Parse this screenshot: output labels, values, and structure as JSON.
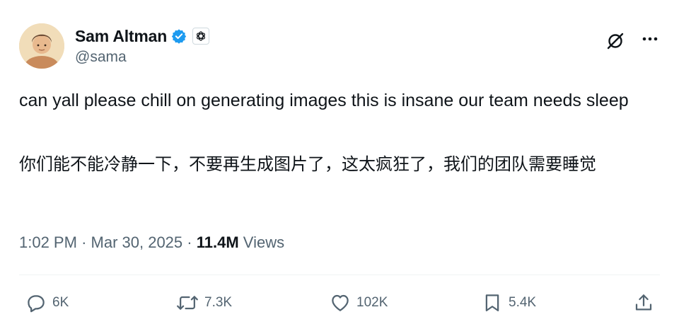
{
  "author": {
    "display_name": "Sam Altman",
    "handle": "@sama",
    "verified": true
  },
  "tweet": {
    "text_en": "can yall please chill on generating images this is insane our team needs sleep",
    "text_zh": "你们能不能冷静一下，不要再生成图片了，这太疯狂了，我们的团队需要睡觉"
  },
  "meta": {
    "time": "1:02 PM",
    "separator": "·",
    "date": "Mar 30, 2025",
    "views_count": "11.4M",
    "views_label": "Views"
  },
  "actions": {
    "replies": "6K",
    "reposts": "7.3K",
    "likes": "102K",
    "bookmarks": "5.4K"
  },
  "icons": {
    "verified": "verified-badge-icon",
    "affiliate": "openai-logo-icon",
    "grok": "grok-icon",
    "more": "more-icon",
    "reply": "reply-icon",
    "repost": "repost-icon",
    "like": "heart-icon",
    "bookmark": "bookmark-icon",
    "share": "share-icon"
  },
  "colors": {
    "verified_blue": "#1d9bf0",
    "text_primary": "#0f1419",
    "text_secondary": "#536471",
    "divider": "#eff3f4"
  }
}
